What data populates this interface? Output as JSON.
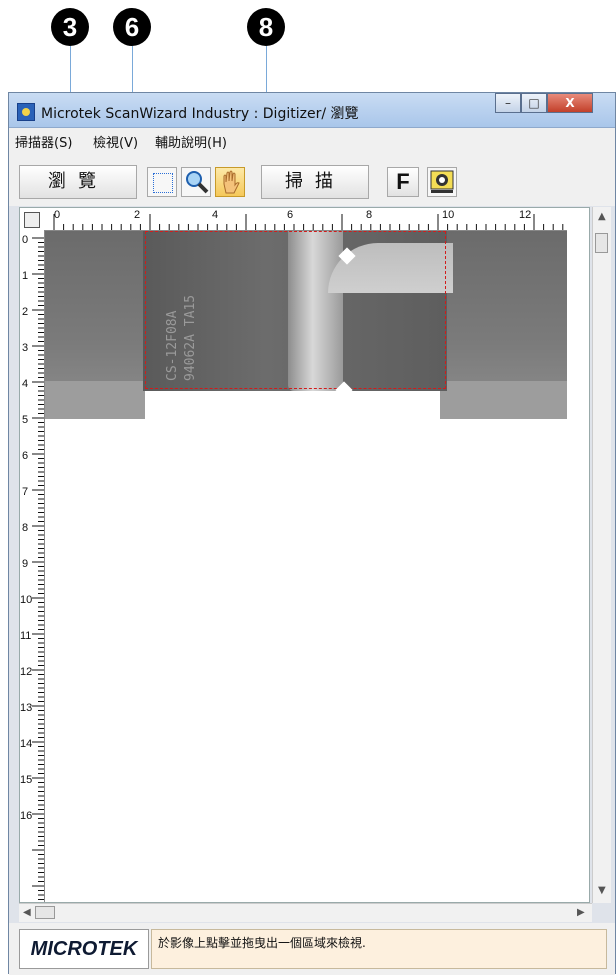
{
  "callouts": [
    "3",
    "6",
    "8"
  ],
  "window": {
    "title": "Microtek ScanWizard Industry : Digitizer/ 瀏覽",
    "minimize": "–",
    "maximize": "□",
    "close": "X"
  },
  "menu": [
    "掃描器(S)",
    "檢視(V)",
    "輔助說明(H)"
  ],
  "toolbar": {
    "preview_label": "瀏覽",
    "scan_label": "掃描",
    "f_label": "F",
    "tools": [
      "selection-tool",
      "zoom-tool",
      "pan-tool"
    ],
    "settings_icon": "gear-icon"
  },
  "ruler": {
    "horizontal": [
      "0",
      "2",
      "4",
      "6",
      "8",
      "10",
      "12"
    ],
    "vertical": [
      "0",
      "1",
      "2",
      "3",
      "4",
      "5",
      "6",
      "7",
      "8",
      "9",
      "10",
      "11",
      "12",
      "13",
      "14",
      "15",
      "16"
    ]
  },
  "preview": {
    "engraving_line1": "CS-12F08A",
    "engraving_line2": "94062A TA15"
  },
  "status": {
    "logo": "MICROTEK",
    "message": "於影像上點擊並拖曳出一個區域來檢視."
  },
  "colors": {
    "selection": "#d21b1b",
    "title_gradient_top": "#c9dcf3",
    "status_bg": "#fdf0de"
  }
}
